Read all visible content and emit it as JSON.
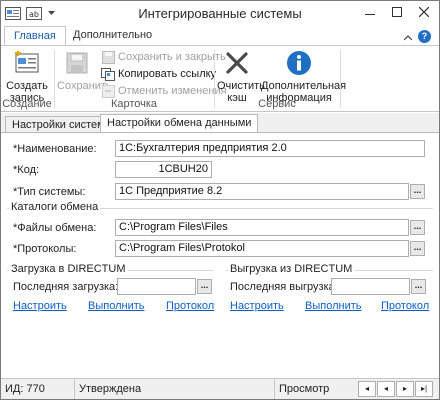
{
  "window": {
    "title": "Интегрированные системы"
  },
  "ribbon": {
    "tabs": [
      {
        "label": "Главная",
        "active": true
      },
      {
        "label": "Дополнительно",
        "active": false
      }
    ],
    "groups": {
      "create": {
        "label": "Создание",
        "create_button": "Создать запись"
      },
      "card": {
        "label": "Карточка",
        "save_button": "Сохранить",
        "save_close_button": "Сохранить и закрыть",
        "copy_link_button": "Копировать ссылку",
        "undo_button": "Отменить изменения"
      },
      "service": {
        "label": "Сервис",
        "clear_cache_button": "Очистить кэш",
        "info_button": "Дополнительная информация"
      }
    }
  },
  "content_tabs": [
    {
      "label": "Настройки системы",
      "active": false
    },
    {
      "label": "Настройки обмена данными",
      "active": true
    }
  ],
  "form": {
    "name": {
      "label": "*Наименование:",
      "value": "1С:Бухгалтерия предприятия 2.0"
    },
    "code": {
      "label": "*Код:",
      "value": "1CBUH20"
    },
    "system_type": {
      "label": "*Тип системы:",
      "value": "1С Предприятие 8.2",
      "button": "..."
    },
    "exchange_dirs": {
      "title": "Каталоги обмена",
      "files": {
        "label": "*Файлы обмена:",
        "value": "C:\\Program Files\\Files",
        "button": "..."
      },
      "protocols": {
        "label": "*Протоколы:",
        "value": "C:\\Program Files\\Protokol",
        "button": "..."
      }
    },
    "import": {
      "title": "Загрузка в DIRECTUM",
      "last_label": "Последняя загрузка:",
      "last_value": "",
      "button": "...",
      "links": [
        "Настроить",
        "Выполнить",
        "Протокол"
      ]
    },
    "export": {
      "title": "Выгрузка из DIRECTUM",
      "last_label": "Последняя выгрузка:",
      "last_value": "",
      "button": "...",
      "links": [
        "Настроить",
        "Выполнить",
        "Протокол"
      ]
    }
  },
  "status_bar": {
    "id": "ИД: 770",
    "state": "Утверждена",
    "mode": "Просмотр",
    "nav": [
      "◂",
      "◂",
      "▸",
      "▸|"
    ]
  }
}
